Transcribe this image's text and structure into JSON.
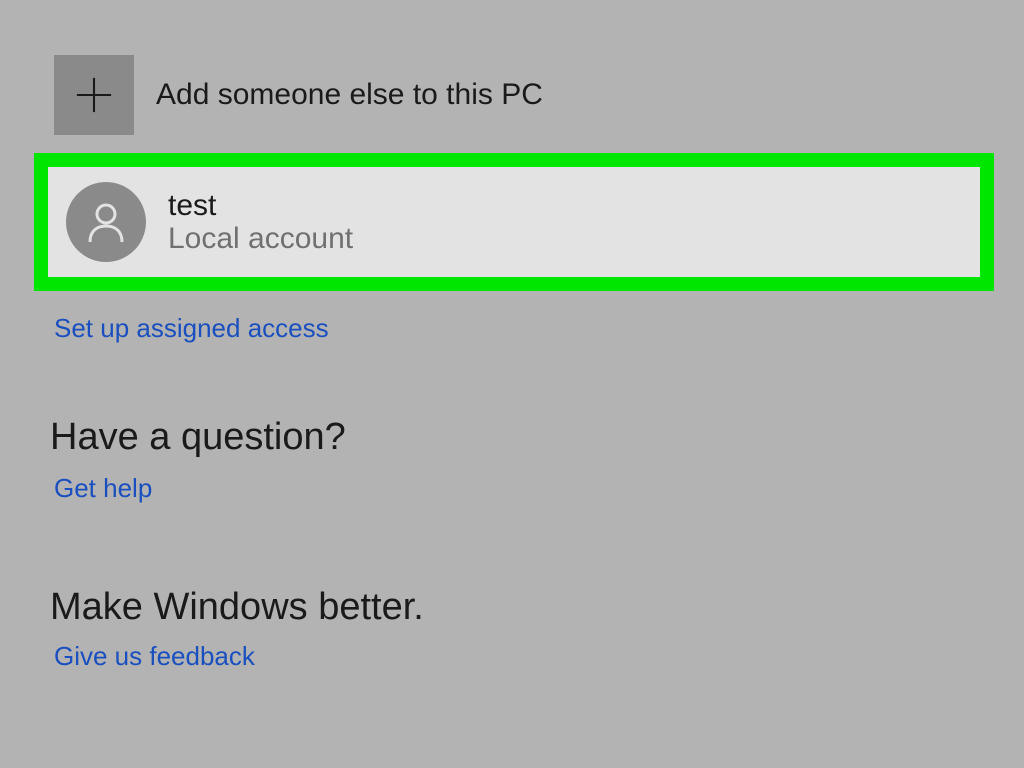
{
  "addUser": {
    "label": "Add someone else to this PC"
  },
  "user": {
    "name": "test",
    "type": "Local account"
  },
  "links": {
    "assignedAccess": "Set up assigned access",
    "getHelp": "Get help",
    "feedback": "Give us feedback"
  },
  "headings": {
    "question": "Have a question?",
    "improve": "Make Windows better."
  }
}
